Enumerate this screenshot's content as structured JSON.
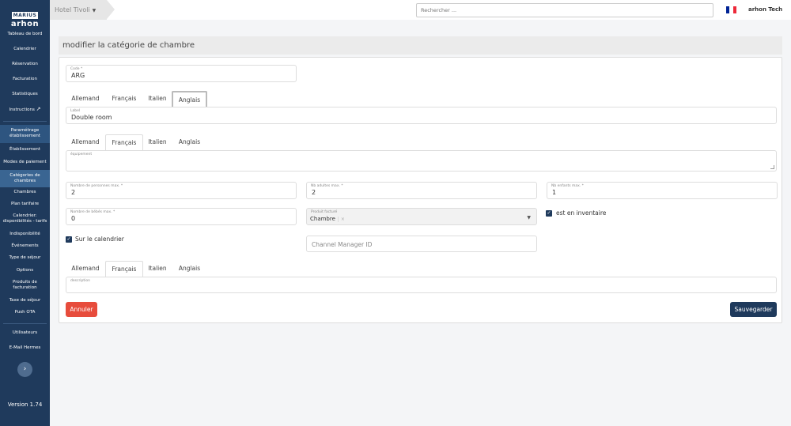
{
  "sidebar": {
    "logo_mark": "MARIUS",
    "logo_text": "arhon",
    "items": [
      {
        "label": "Tableau de bord"
      },
      {
        "label": "Calendrier"
      },
      {
        "label": "Réservation"
      },
      {
        "label": "Facturation"
      },
      {
        "label": "Statistiques"
      },
      {
        "label": "Instructions"
      },
      {
        "label": "Paramétrage établissement"
      },
      {
        "label": "Établissement"
      },
      {
        "label": "Modes de paiement"
      },
      {
        "label": "Catégories de chambres"
      },
      {
        "label": "Chambres"
      },
      {
        "label": "Plan tarifaire"
      },
      {
        "label": "Calendrier: disponibilités - tarifs"
      },
      {
        "label": "Indisponibilité"
      },
      {
        "label": "Événements"
      },
      {
        "label": "Type de séjour"
      },
      {
        "label": "Options"
      },
      {
        "label": "Produits de facturation"
      },
      {
        "label": "Taxe de séjour"
      },
      {
        "label": "Push OTA"
      },
      {
        "label": "Utilisateurs"
      },
      {
        "label": "E-Mail Hermes"
      }
    ],
    "version": "Version 1.74"
  },
  "topbar": {
    "hotel": "Hotel Tivoli",
    "search_placeholder": "Rechercher ...",
    "user": "arhon Tech",
    "flag_colors": [
      "#002395",
      "#ffffff",
      "#ed2939"
    ]
  },
  "page": {
    "title": "modifier la catégorie de chambre"
  },
  "form": {
    "code_label": "Code *",
    "code_value": "ARG",
    "label_tabs": [
      "Allemand",
      "Français",
      "Italien",
      "Anglais"
    ],
    "label_label": "Label",
    "label_value": "Double room",
    "equip_tabs": [
      "Allemand",
      "Français",
      "Italien",
      "Anglais"
    ],
    "equip_label": "équipement",
    "max_persons_label": "Nombre de personnes max. *",
    "max_persons_value": "2",
    "max_adults_label": "Nb adultes max. *",
    "max_adults_value": "2",
    "max_children_label": "Nb enfants max. *",
    "max_children_value": "1",
    "max_babies_label": "Nombre de bébés max. *",
    "max_babies_value": "0",
    "product_label": "Produit facturé",
    "product_value": "Chambre",
    "inventory_label": "est en inventaire",
    "calendar_label": "Sur le calendrier",
    "channel_placeholder": "Channel Manager ID",
    "desc_tabs": [
      "Allemand",
      "Français",
      "Italien",
      "Anglais"
    ],
    "desc_label": "description",
    "cancel": "Annuler",
    "save": "Sauvegarder"
  }
}
